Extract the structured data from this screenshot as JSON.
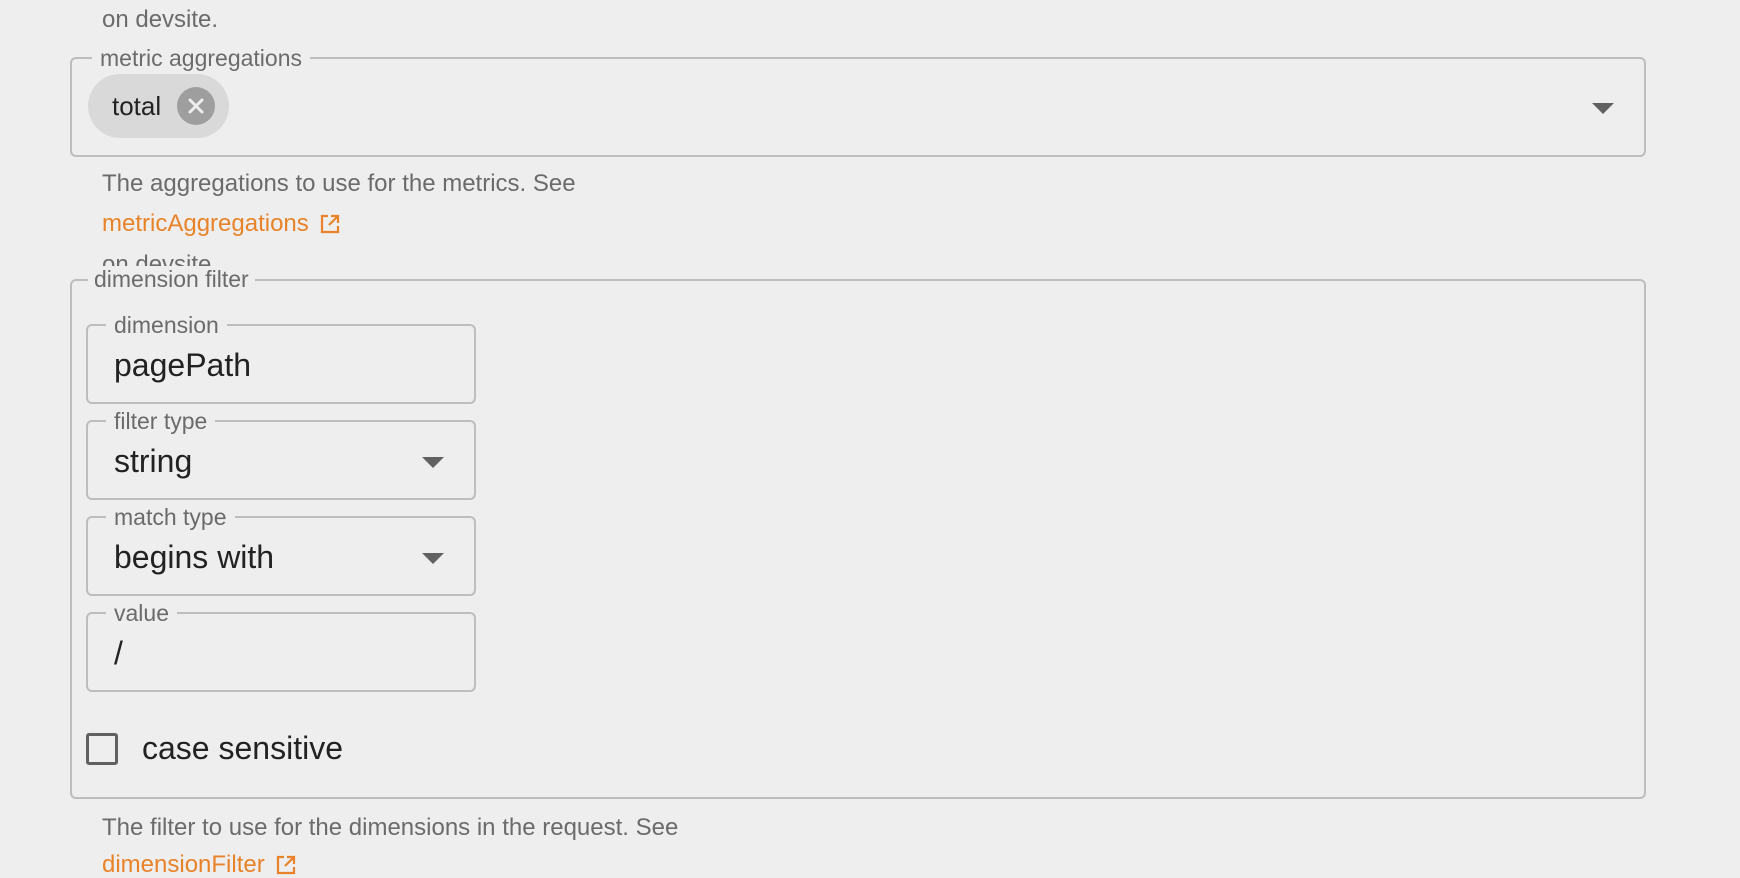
{
  "prev_help": {
    "tail": "on devsite."
  },
  "metric_aggregations": {
    "legend": "metric aggregations",
    "chips": [
      {
        "label": "total"
      }
    ],
    "dropdown_icon": "arrow-drop-down-icon",
    "help_text": "The aggregations to use for the metrics. See",
    "link_text": "metricAggregations",
    "link_icon": "open-in-new-icon",
    "help_tail": "on devsite."
  },
  "dimension_filter": {
    "legend": "dimension filter",
    "fields": {
      "dimension": {
        "label": "dimension",
        "value": "pagePath"
      },
      "filter_type": {
        "label": "filter type",
        "value": "string"
      },
      "match_type": {
        "label": "match type",
        "value": "begins with"
      },
      "value": {
        "label": "value",
        "value": "/"
      }
    },
    "case_sensitive": {
      "label": "case sensitive",
      "checked": false
    },
    "help_text": "The filter to use for the dimensions in the request. See",
    "link_text": "dimensionFilter",
    "link_icon": "open-in-new-icon"
  },
  "colors": {
    "background": "#eeeeee",
    "link": "#e8832a",
    "border": "#bdbdbd",
    "chip": "#d9d9d9",
    "muted_text": "#6b6b6b"
  }
}
